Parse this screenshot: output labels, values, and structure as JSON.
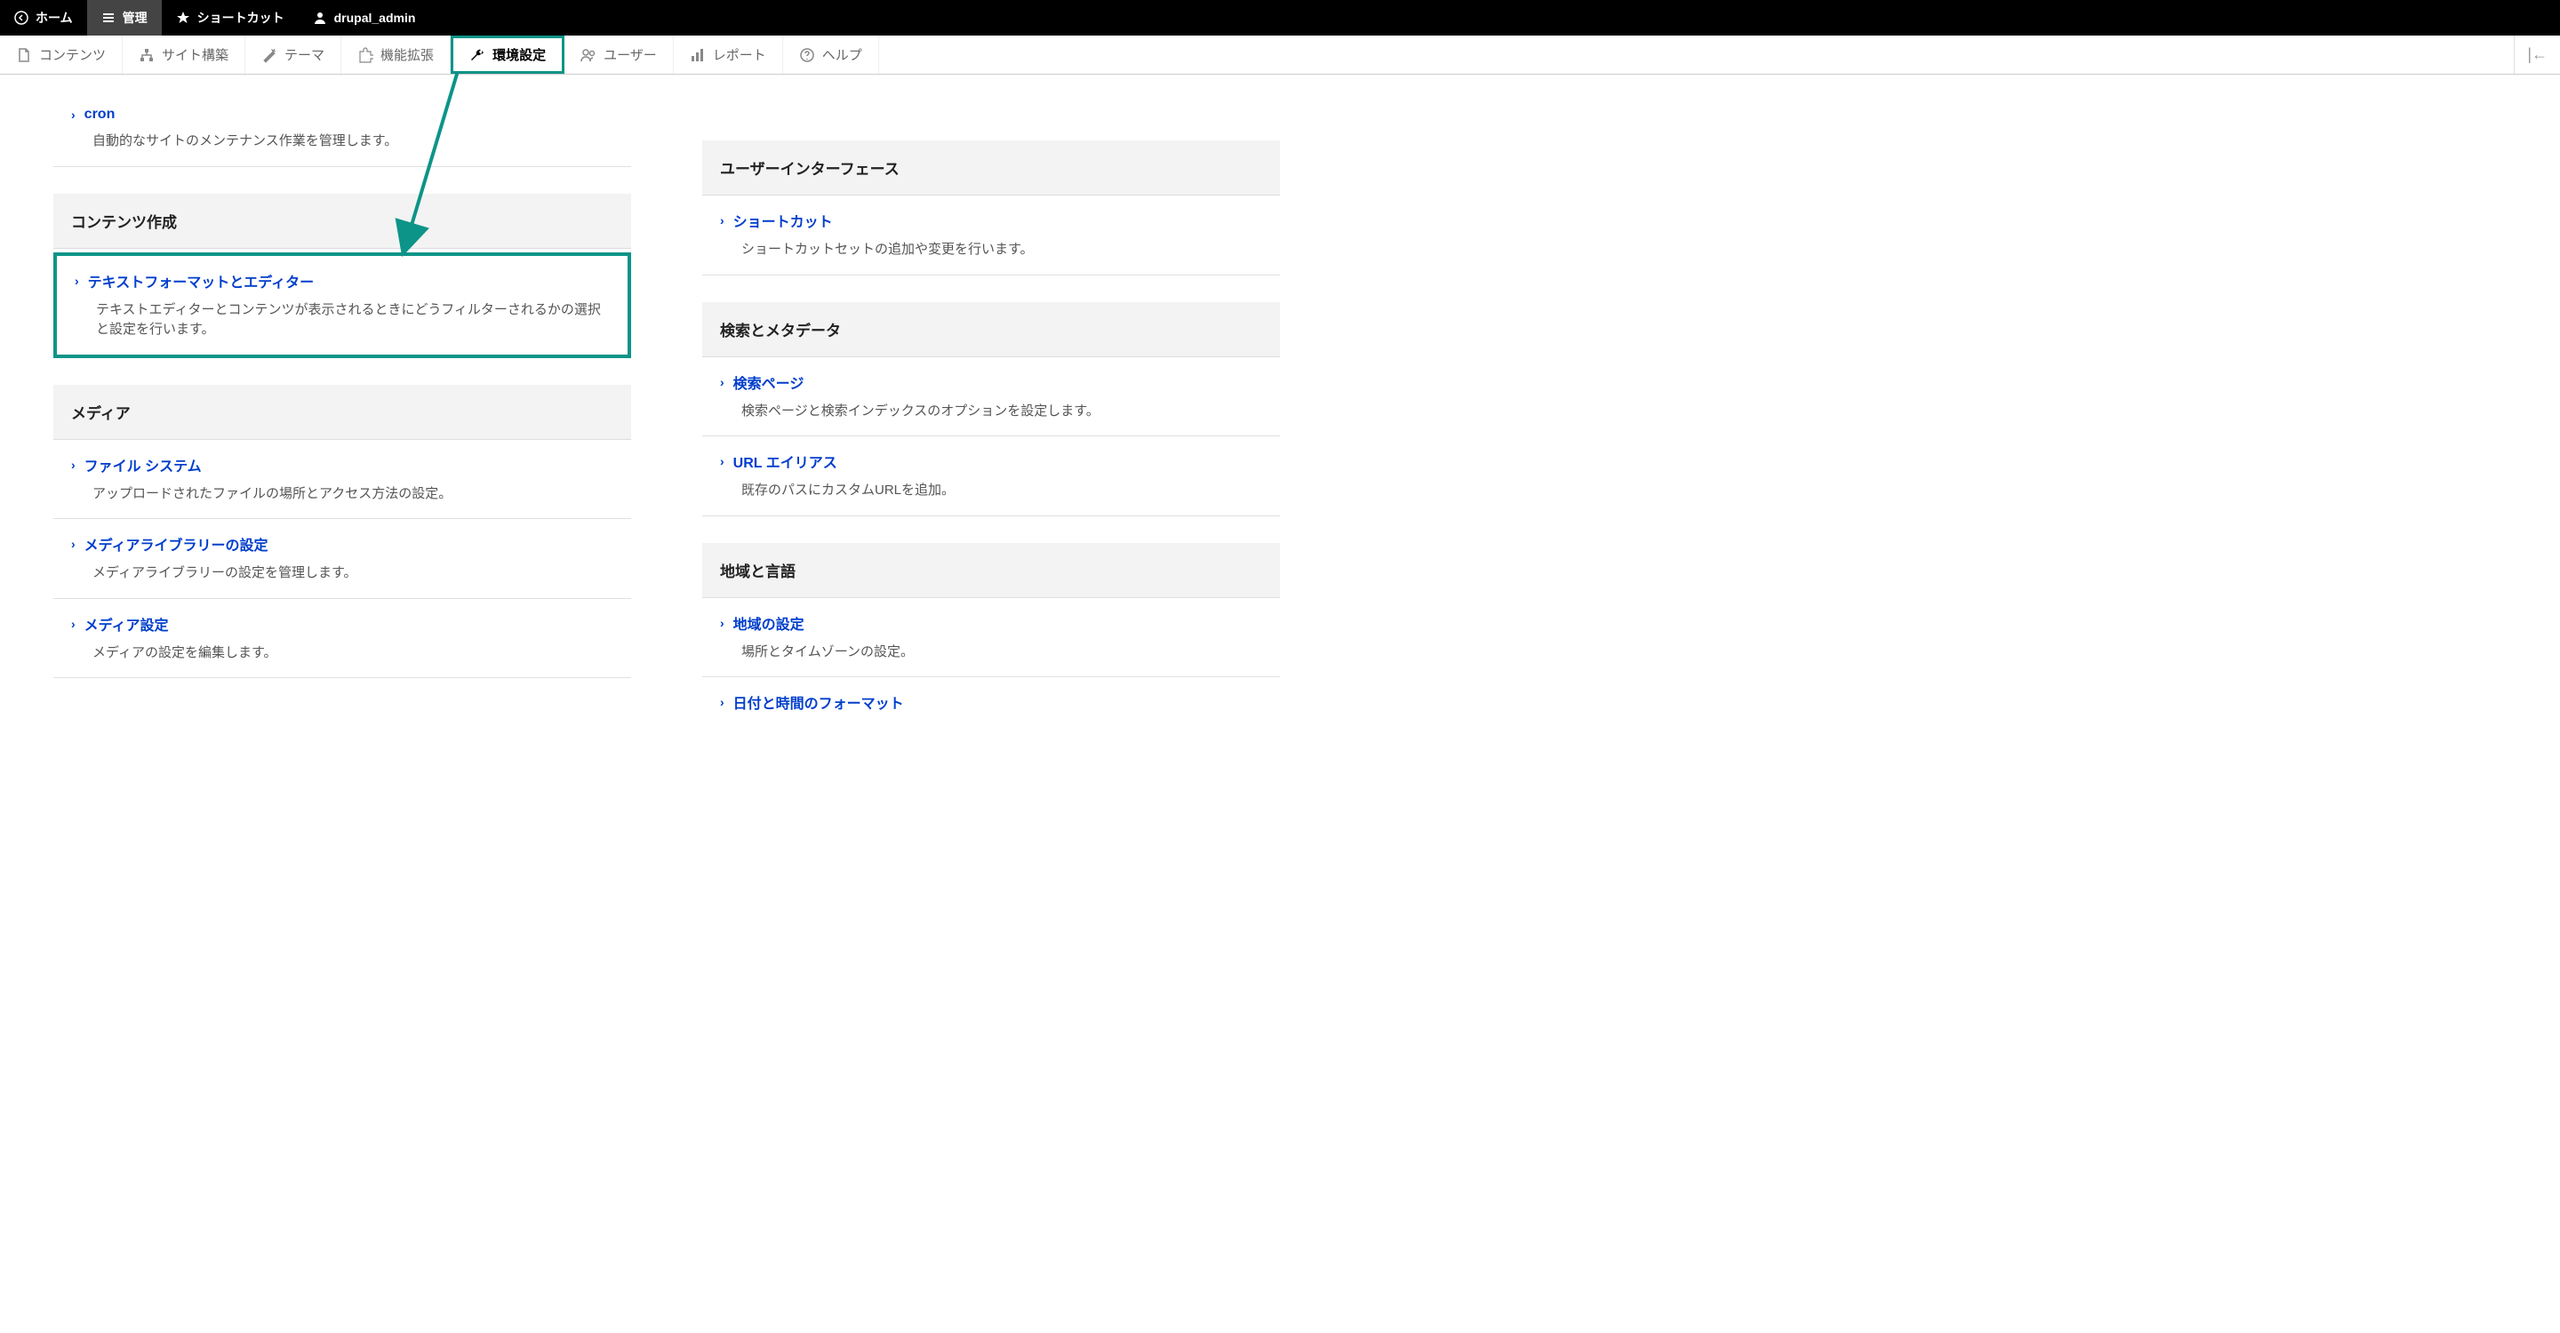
{
  "colors": {
    "accent": "#0d9488",
    "link": "#003ecc"
  },
  "toolbar": {
    "home": "ホーム",
    "admin": "管理",
    "shortcuts": "ショートカット",
    "user": "drupal_admin"
  },
  "tabs": {
    "content": "コンテンツ",
    "structure": "サイト構築",
    "appearance": "テーマ",
    "extend": "機能拡張",
    "configuration": "環境設定",
    "people": "ユーザー",
    "reports": "レポート",
    "help": "ヘルプ"
  },
  "leftColumn": {
    "cron": {
      "title": "cron",
      "desc": "自動的なサイトのメンテナンス作業を管理します。"
    },
    "contentCreation": {
      "header": "コンテンツ作成",
      "textFormats": {
        "title": "テキストフォーマットとエディター",
        "desc": "テキストエディターとコンテンツが表示されるときにどうフィルターされるかの選択と設定を行います。"
      }
    },
    "media": {
      "header": "メディア",
      "fileSystem": {
        "title": "ファイル システム",
        "desc": "アップロードされたファイルの場所とアクセス方法の設定。"
      },
      "mediaLibrary": {
        "title": "メディアライブラリーの設定",
        "desc": "メディアライブラリーの設定を管理します。"
      },
      "mediaSettings": {
        "title": "メディア設定",
        "desc": "メディアの設定を編集します。"
      }
    }
  },
  "rightColumn": {
    "ui": {
      "header": "ユーザーインターフェース",
      "shortcuts": {
        "title": "ショートカット",
        "desc": "ショートカットセットの追加や変更を行います。"
      }
    },
    "search": {
      "header": "検索とメタデータ",
      "searchPages": {
        "title": "検索ページ",
        "desc": "検索ページと検索インデックスのオプションを設定します。"
      },
      "urlAlias": {
        "title": "URL エイリアス",
        "desc": "既存のパスにカスタムURLを追加。"
      }
    },
    "regional": {
      "header": "地域と言語",
      "regionSettings": {
        "title": "地域の設定",
        "desc": "場所とタイムゾーンの設定。"
      },
      "dateTime": {
        "title": "日付と時間のフォーマット"
      }
    }
  }
}
